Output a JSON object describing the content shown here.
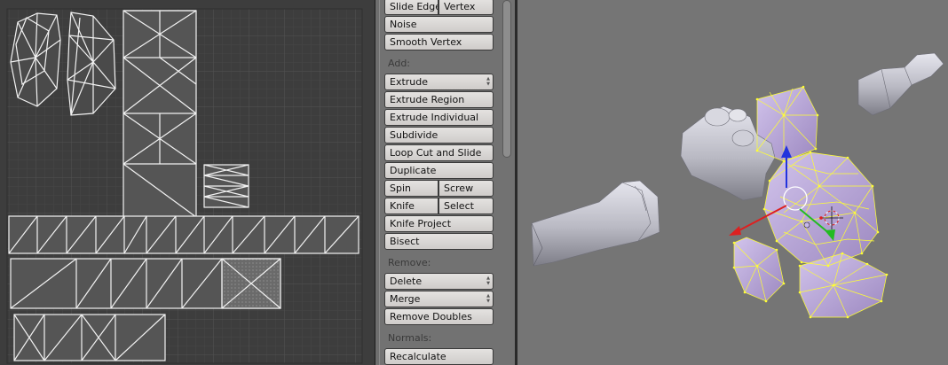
{
  "tool_shelf": {
    "top_buttons": [
      {
        "left": "Slide Edge",
        "right": "Vertex"
      },
      {
        "label": "Noise"
      },
      {
        "label": "Smooth Vertex"
      }
    ],
    "add_section": {
      "label": "Add:",
      "extrude": "Extrude",
      "extrude_region": "Extrude Region",
      "extrude_individual": "Extrude Individual",
      "subdivide": "Subdivide",
      "loop_cut": "Loop Cut and Slide",
      "duplicate": "Duplicate",
      "spin": "Spin",
      "screw": "Screw",
      "knife": "Knife",
      "select": "Select",
      "knife_project": "Knife Project",
      "bisect": "Bisect"
    },
    "remove_section": {
      "label": "Remove:",
      "delete": "Delete",
      "merge": "Merge",
      "remove_doubles": "Remove Doubles"
    },
    "normals_section": {
      "label": "Normals:",
      "recalculate": "Recalculate"
    }
  },
  "colors": {
    "uv_background": "#3d3d3d",
    "panel_background": "#727272",
    "viewport_background": "#757575",
    "wire_selected": "#ffff33",
    "mesh_purple": "#b8a6d6",
    "axis_x": "#dd2020",
    "axis_y": "#22bb22",
    "axis_z": "#2233dd"
  },
  "icons": {
    "uv_editor": "uv-map-editor",
    "viewport": "3d-viewport",
    "manipulator": "transform-manipulator-icon",
    "cursor": "3d-cursor-icon"
  }
}
